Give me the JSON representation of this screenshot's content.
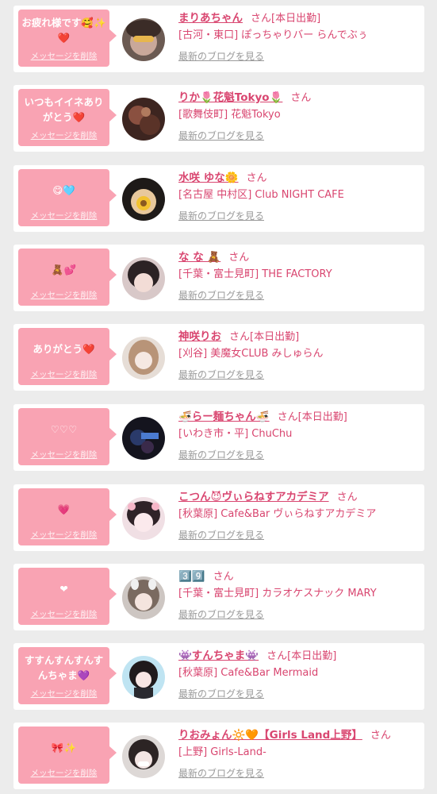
{
  "delete_label": "メッセージを削除",
  "blog_label": "最新のブログを見る",
  "san_label": "さん",
  "today_label": "[本日出勤]",
  "colors": {
    "bubble": "#f9a3b3",
    "accent": "#d94670",
    "muted": "#9a9a9a",
    "background": "#ececec"
  },
  "items": [
    {
      "message": "お疲れ様です🥰✨❤️",
      "name": "まりあちゃん",
      "today": true,
      "shop": "[古河・東口] ぽっちゃりバー らんでぶぅ"
    },
    {
      "message": "いつもイイネありがとう❤️",
      "name": "りか🌷花魁Tokyo🌷",
      "today": false,
      "shop": "[歌舞伎町] 花魁Tokyo"
    },
    {
      "message": "😋🩵",
      "name": "水咲 ゆな🌼",
      "today": false,
      "shop": "[名古屋 中村区] Club NIGHT CAFE"
    },
    {
      "message": "🧸💕",
      "name": "な な 🧸",
      "today": false,
      "shop": "[千葉・富士見町] THE FACTORY"
    },
    {
      "message": "ありがとう❤️",
      "name": "神咲りお",
      "today": true,
      "shop": "[刈谷] 美魔女CLUB みしゅらん"
    },
    {
      "message": "♡♡♡",
      "name": "🍜らー麺ちゃん🍜",
      "today": true,
      "shop": "[いわき市・平] ChuChu"
    },
    {
      "message": "💗",
      "name": "こつん😈ヴぃらねすアカデミア",
      "today": false,
      "shop": "[秋葉原] Cafe&Bar ヴぃらねすアカデミア"
    },
    {
      "message": "❤",
      "name": "3️⃣9️⃣",
      "today": false,
      "shop": "[千葉・富士見町] カラオケスナック MARY"
    },
    {
      "message": "すすんすんすんすんちゃま💜",
      "name": "👾すんちゃま👾",
      "today": true,
      "shop": "[秋葉原] Cafe&Bar Mermaid"
    },
    {
      "message": "🎀✨",
      "name": "りおみょん🔆🧡【Girls Land上野】",
      "today": false,
      "shop": "[上野] Girls-Land-"
    }
  ]
}
